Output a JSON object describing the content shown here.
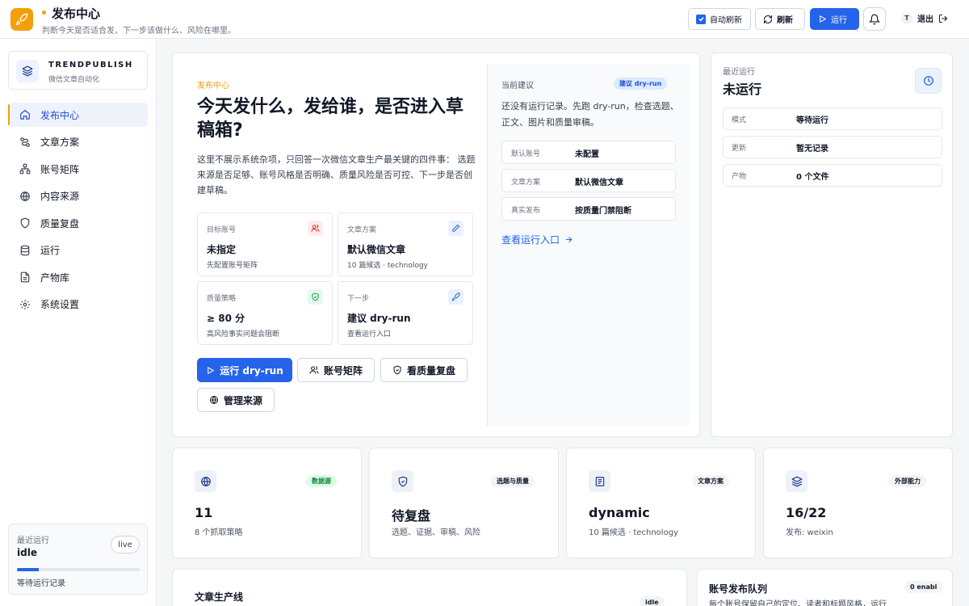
{
  "header": {
    "title": "发布中心",
    "subtitle": "判断今天是否适合发、下一步该做什么、风险在哪里。",
    "auto_refresh": "自动刷新",
    "refresh": "刷新",
    "run": "运行",
    "user_initial": "T",
    "logout": "退出"
  },
  "sidebar": {
    "brand_name": "TRENDPUBLISH",
    "brand_sub": "微信文章自动化",
    "items": [
      {
        "label": "发布中心",
        "icon": "home-icon"
      },
      {
        "label": "文章方案",
        "icon": "route-icon"
      },
      {
        "label": "账号矩阵",
        "icon": "network-icon"
      },
      {
        "label": "内容来源",
        "icon": "globe-icon"
      },
      {
        "label": "质量复盘",
        "icon": "shield-icon"
      },
      {
        "label": "运行",
        "icon": "database-icon"
      },
      {
        "label": "产物库",
        "icon": "file-icon"
      },
      {
        "label": "系统设置",
        "icon": "gear-icon"
      }
    ],
    "run": {
      "label": "最近运行",
      "value": "idle",
      "badge": "live",
      "progress": 0.18,
      "foot": "等待运行记录"
    }
  },
  "hero": {
    "eyebrow": "发布中心",
    "title": "今天发什么，发给谁，是否进入草稿箱?",
    "desc": "这里不展示系统杂项，只回答一次微信文章生产最关键的四件事： 选题来源是否足够、账号风格是否明确、质量风险是否可控、下一步是否创建草稿。",
    "cards": [
      {
        "k": "目标账号",
        "v": "未指定",
        "s": "先配置账号矩阵"
      },
      {
        "k": "文章方案",
        "v": "默认微信文章",
        "s": "10 篇候选 · technology"
      },
      {
        "k": "质量策略",
        "v": "≥ 80 分",
        "s": "高风险事实问题会阻断"
      },
      {
        "k": "下一步",
        "v": "建议 dry-run",
        "s": "查看运行入口"
      }
    ],
    "actions": {
      "run": "运行 dry-run",
      "accounts": "账号矩阵",
      "quality": "看质量复盘",
      "sources": "管理来源"
    }
  },
  "suggest": {
    "title": "当前建议",
    "badge": "建议 dry-run",
    "text": "还没有运行记录。先跑 dry-run，检查选题、正文、图片和质量审稿。",
    "rows": [
      {
        "k": "默认账号",
        "v": "未配置"
      },
      {
        "k": "文章方案",
        "v": "默认微信文章"
      },
      {
        "k": "真实发布",
        "v": "按质量门禁阻断"
      }
    ],
    "link": "查看运行入口"
  },
  "recent": {
    "label": "最近运行",
    "value": "未运行",
    "rows": [
      {
        "k": "模式",
        "v": "等待运行"
      },
      {
        "k": "更新",
        "v": "暂无记录"
      },
      {
        "k": "产物",
        "v": "0 个文件"
      }
    ]
  },
  "stats": [
    {
      "badge": "数据源",
      "value": "11",
      "sub": "8 个抓取策略"
    },
    {
      "badge": "选题与质量",
      "value": "待复盘",
      "sub": "选题、证据、审稿、风险"
    },
    {
      "badge": "文章方案",
      "value": "dynamic",
      "sub": "10 篇候选 · technology"
    },
    {
      "badge": "外部能力",
      "value": "16/22",
      "sub": "发布: weixin"
    }
  ],
  "pipeline": {
    "title": "文章生产线",
    "badge": "idle"
  },
  "queue": {
    "title": "账号发布队列",
    "badge": "0 enabl",
    "sub": "每个账号保留自己的定位、读者和标题风格，运行"
  },
  "colors": {
    "accent": "#2563eb",
    "brand": "#f59e0b"
  }
}
